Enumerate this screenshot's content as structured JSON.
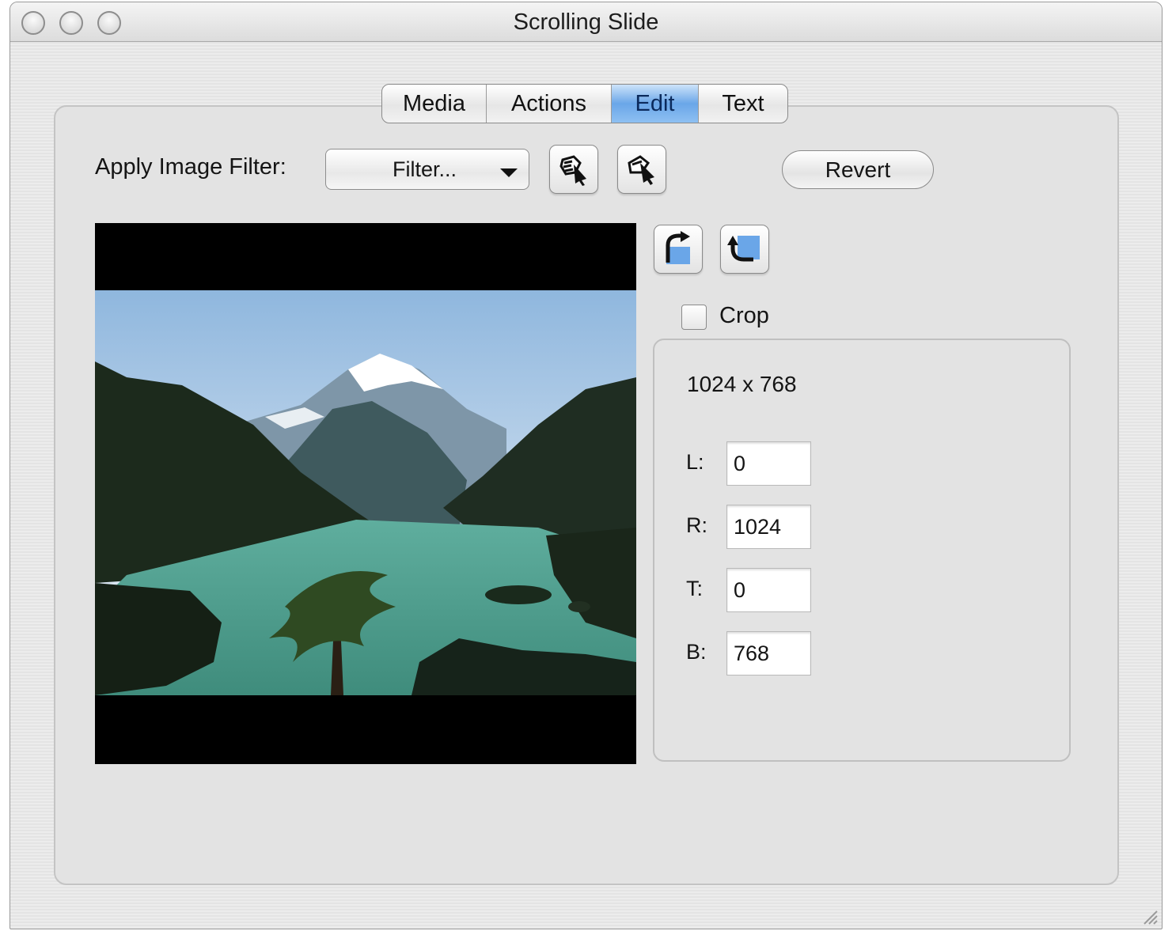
{
  "window": {
    "title": "Scrolling Slide"
  },
  "tabs": [
    {
      "label": "Media",
      "active": false
    },
    {
      "label": "Actions",
      "active": false
    },
    {
      "label": "Edit",
      "active": true
    },
    {
      "label": "Text",
      "active": false
    }
  ],
  "filter": {
    "label": "Apply Image Filter:",
    "selected": "Filter..."
  },
  "toolbar": {
    "apply_filter_icon": "magic-wand-apply-icon",
    "undo_filter_icon": "magic-wand-undo-icon",
    "revert_label": "Revert",
    "rotate_cw_icon": "rotate-clockwise-icon",
    "rotate_ccw_icon": "rotate-counterclockwise-icon"
  },
  "preview": {
    "image_description": "mountain-lake-landscape-photo"
  },
  "crop": {
    "checkbox_label": "Crop",
    "checked": false,
    "dimensions": "1024 x 768",
    "fields": [
      {
        "label": "L:",
        "value": "0"
      },
      {
        "label": "R:",
        "value": "1024"
      },
      {
        "label": "T:",
        "value": "0"
      },
      {
        "label": "B:",
        "value": "768"
      }
    ]
  },
  "colors": {
    "active_tab": "#6aa6e8",
    "panel": "#e3e3e3"
  }
}
